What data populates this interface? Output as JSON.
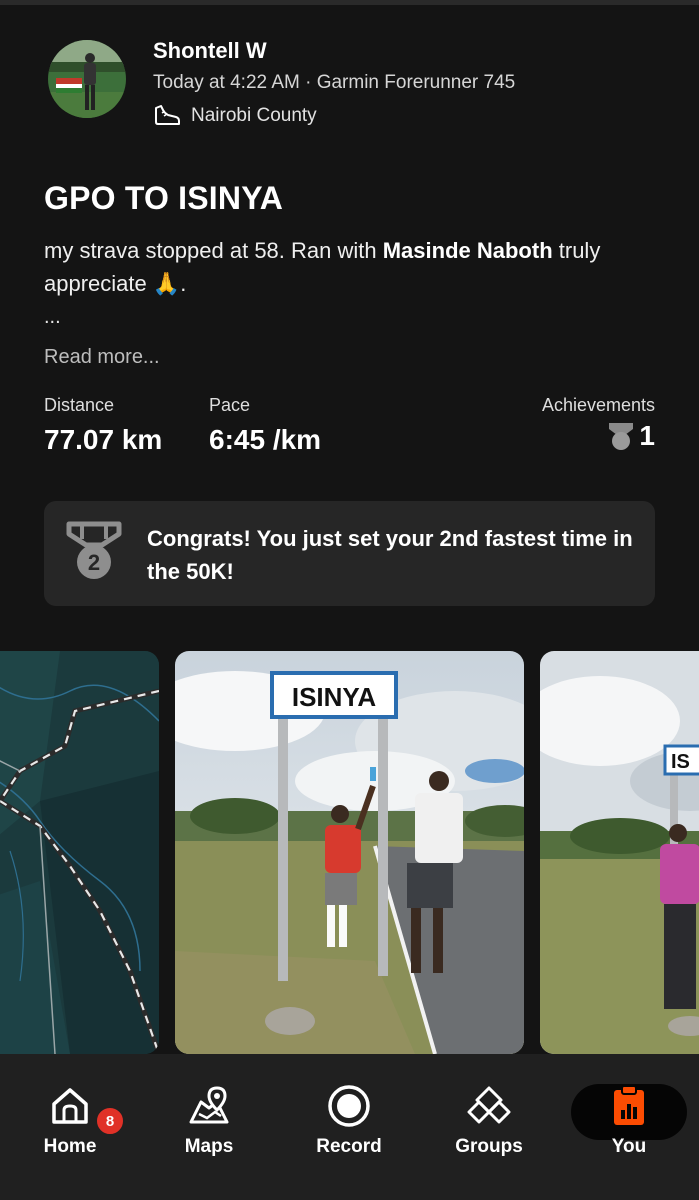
{
  "header": {
    "user_name": "Shontell W",
    "meta": "Today at 4:22 AM · Garmin Forerunner 745",
    "location": "Nairobi County"
  },
  "activity": {
    "title": "GPO TO ISINYA",
    "desc_part1": "my strava stopped at 58. Ran with ",
    "desc_bold": "Masinde Naboth",
    "desc_part2": " truly appreciate 🙏.",
    "ellipsis": "...",
    "read_more": "Read more..."
  },
  "stats": {
    "distance_label": "Distance",
    "distance_value": "77.07 km",
    "pace_label": "Pace",
    "pace_value": "6:45 /km",
    "achievements_label": "Achievements",
    "achievements_value": "1"
  },
  "congrats": {
    "medal_number": "2",
    "message": "Congrats! You just set your 2nd fastest time in the 50K!"
  },
  "photo": {
    "sign_text": "ISINYA",
    "sign_text_partial": "IS"
  },
  "nav": {
    "home": "Home",
    "home_badge": "8",
    "maps": "Maps",
    "record": "Record",
    "groups": "Groups",
    "you": "You"
  },
  "colors": {
    "background": "#141414",
    "card": "#262626",
    "nav_bg": "#202020",
    "accent": "#fc4c02",
    "badge": "#e03127"
  }
}
